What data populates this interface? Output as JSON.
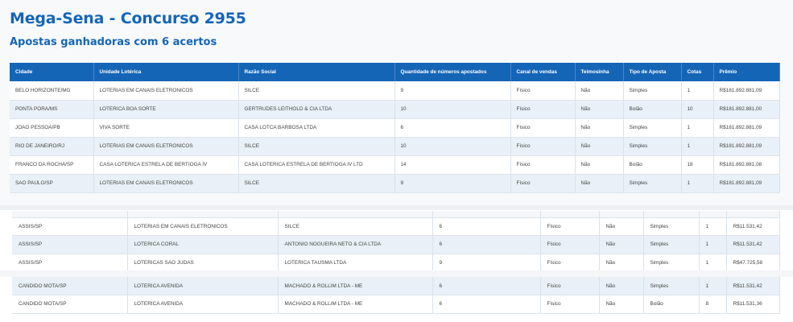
{
  "page": {
    "title": "Mega-Sena - Concurso 2955",
    "subtitle": "Apostas ganhadoras com 6 acertos"
  },
  "winners_table": {
    "headers": [
      "Cidade",
      "Unidade Lotérica",
      "Razão Social",
      "Quantidade de números apostados",
      "Canal de vendas",
      "Teimosinha",
      "Tipo de Aposta",
      "Cotas",
      "Prêmio"
    ],
    "rows": [
      [
        "BELO HORIZONTE/MG",
        "LOTERIAS EM CANAIS ELETRONICOS",
        "SILCE",
        "9",
        "Físico",
        "Não",
        "Simples",
        "1",
        "R$181.892.881,09"
      ],
      [
        "PONTA PORA/MS",
        "LOTERICA BOA SORTE",
        "GERTRUDES LEITHOLD & CIA LTDA",
        "10",
        "Físico",
        "Não",
        "Bolão",
        "10",
        "R$181.892.881,00"
      ],
      [
        "JOAO PESSOA/PB",
        "VIVA SORTE",
        "CASA LOTCA BARBOSA LTDA",
        "6",
        "Físico",
        "Não",
        "Simples",
        "1",
        "R$181.892.881,09"
      ],
      [
        "RIO DE JANEIRO/RJ",
        "LOTERIAS EM CANAIS ELETRONICOS",
        "SILCE",
        "10",
        "Físico",
        "Não",
        "Simples",
        "1",
        "R$181.892.881,09"
      ],
      [
        "FRANCO DA ROCHA/SP",
        "CASA LOTERICA ESTRELA DE BERTIOGA IV",
        "CASA LOTERICA ESTRELA DE BERTIOGA IV LTD",
        "14",
        "Físico",
        "Não",
        "Bolão",
        "18",
        "R$181.892.881,08"
      ],
      [
        "SAO PAULO/SP",
        "LOTERIAS EM CANAIS ELETRONICOS",
        "SILCE",
        "9",
        "Físico",
        "Não",
        "Simples",
        "1",
        "R$181.892.881,09"
      ]
    ]
  },
  "fragment_a": {
    "rows": [
      [
        "ASSIS/SP",
        "LOTERIAS EM CANAIS ELETRONICOS",
        "SILCE",
        "6",
        "Físico",
        "Não",
        "Simples",
        "1",
        "R$11.531,42"
      ],
      [
        "ASSIS/SP",
        "LOTERICA CORAL",
        "ANTONIO NOGUEIRA NETO & CIA LTDA",
        "6",
        "Físico",
        "Não",
        "Simples",
        "1",
        "R$11.531,42"
      ],
      [
        "ASSIS/SP",
        "LOTERICAS SAO JUDAS",
        "LOTERICA TAUSMA LTDA",
        "9",
        "Físico",
        "Não",
        "Simples",
        "1",
        "R$47.725,58"
      ]
    ]
  },
  "fragment_b": {
    "rows": [
      [
        "CANDIDO MOTA/SP",
        "LOTERICA AVENIDA",
        "MACHADO & ROLLIM LTDA - ME",
        "6",
        "Físico",
        "Não",
        "Simples",
        "1",
        "R$11.531,42"
      ],
      [
        "CANDIDO MOTA/SP",
        "LOTERICA AVENIDA",
        "MACHADO & ROLLIM LTDA - ME",
        "6",
        "Físico",
        "Não",
        "Bolão",
        "8",
        "R$11.531,36"
      ]
    ]
  },
  "colors": {
    "brand": "#1565b7",
    "header_bg": "#1565b7",
    "row_alt": "#e9f0f7"
  }
}
